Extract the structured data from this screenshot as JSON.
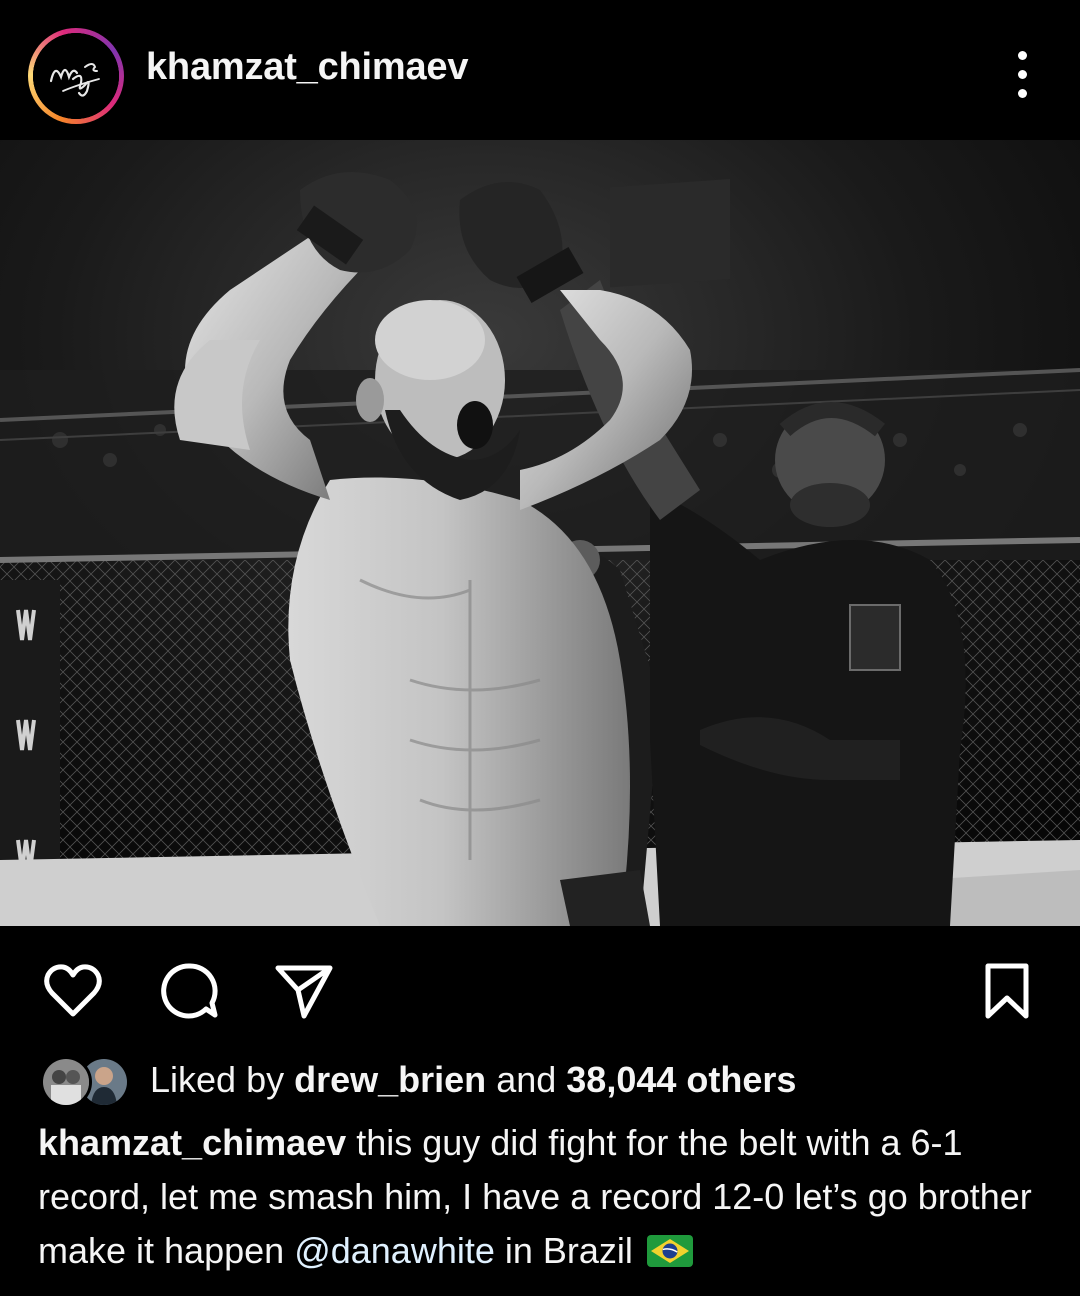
{
  "post": {
    "username": "khamzat_chimaev",
    "avatar_icon": "signature-logo-icon",
    "more_icon": "more-vertical-icon",
    "photo_description_icon": "post-photo",
    "actions": {
      "like_icon": "heart-icon",
      "comment_icon": "comment-icon",
      "share_icon": "send-icon",
      "save_icon": "bookmark-icon"
    },
    "likes": {
      "prefix": "Liked by",
      "liker": "drew_brien",
      "connector": "and",
      "count": "38,044 others"
    },
    "caption": {
      "username": "khamzat_chimaev",
      "text_before": "this guy did fight for the belt with a 6-1 record, let me smash him, I have a record 12-0 let’s go brother make it happen",
      "mention": "@danawhite",
      "text_after": "in Brazil",
      "flag_icon": "brazil-flag-icon"
    }
  },
  "colors": {
    "background": "#000000",
    "text": "#f5f5f5",
    "mention": "#e0f1ff"
  }
}
